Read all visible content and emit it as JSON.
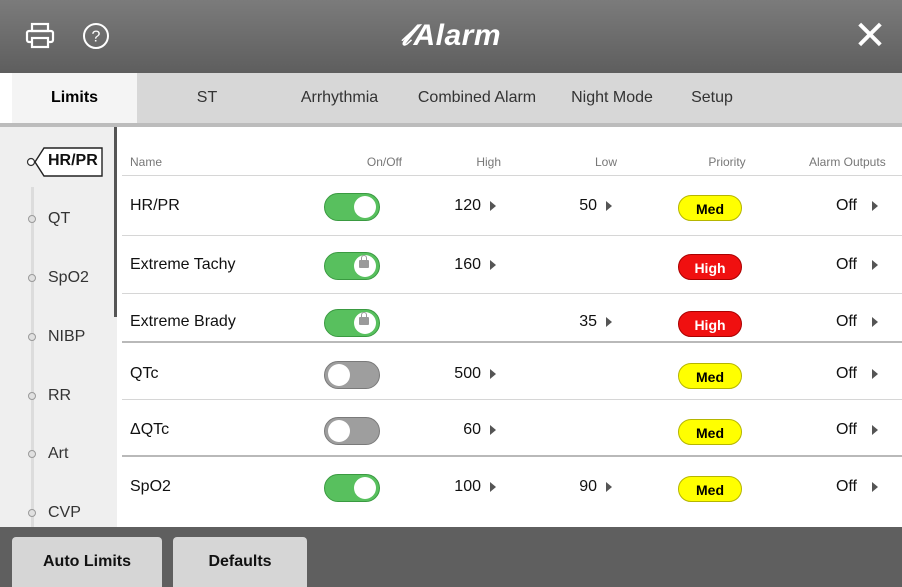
{
  "window": {
    "title": "Alarm",
    "close_glyph": "✕",
    "icons": [
      "printer-icon",
      "help-icon",
      "alarm-logo-icon",
      "close-icon"
    ]
  },
  "tabs": [
    {
      "label": "Limits",
      "active": true
    },
    {
      "label": "ST",
      "active": false
    },
    {
      "label": "Arrhythmia",
      "active": false
    },
    {
      "label": "Combined Alarm",
      "active": false
    },
    {
      "label": "Night Mode",
      "active": false
    },
    {
      "label": "Setup",
      "active": false
    }
  ],
  "sidebar": {
    "items": [
      {
        "label": "HR/PR",
        "selected": true
      },
      {
        "label": "QT"
      },
      {
        "label": "SpO2"
      },
      {
        "label": "NIBP"
      },
      {
        "label": "RR"
      },
      {
        "label": "Art"
      },
      {
        "label": "CVP"
      }
    ]
  },
  "table": {
    "columns": [
      "Name",
      "On/Off",
      "High",
      "Low",
      "Priority",
      "Alarm Outputs"
    ],
    "rows": [
      {
        "name": "HR/PR",
        "on": true,
        "locked": false,
        "high": "120",
        "low": "50",
        "priority": "Med",
        "outputs": "Off"
      },
      {
        "name": "Extreme Tachy",
        "on": true,
        "locked": true,
        "high": "160",
        "low": "",
        "priority": "High",
        "outputs": "Off"
      },
      {
        "name": "Extreme Brady",
        "on": true,
        "locked": true,
        "high": "",
        "low": "35",
        "priority": "High",
        "outputs": "Off"
      },
      {
        "name": "QTc",
        "on": false,
        "locked": false,
        "high": "500",
        "low": "",
        "priority": "Med",
        "outputs": "Off"
      },
      {
        "name": "ΔQTc",
        "on": false,
        "locked": false,
        "high": "60",
        "low": "",
        "priority": "Med",
        "outputs": "Off"
      },
      {
        "name": "SpO2",
        "on": true,
        "locked": false,
        "high": "100",
        "low": "90",
        "priority": "Med",
        "outputs": "Off"
      }
    ]
  },
  "footer": {
    "auto_limits_label": "Auto Limits",
    "defaults_label": "Defaults"
  },
  "colors": {
    "toggle_on": "#58c05e",
    "toggle_off": "#9e9e9e",
    "priority_med": "#ffff00",
    "priority_high": "#f01010"
  }
}
